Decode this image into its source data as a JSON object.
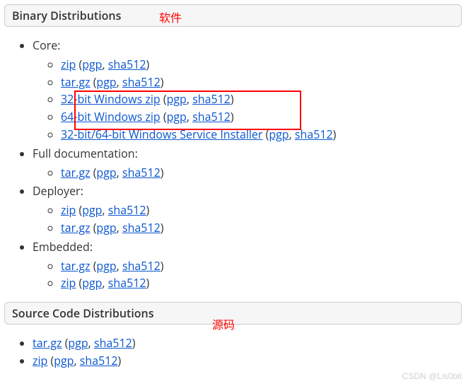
{
  "binary": {
    "header": "Binary Distributions",
    "core_label": "Core:",
    "full_doc_label": "Full documentation:",
    "deployer_label": "Deployer:",
    "embedded_label": "Embedded:",
    "items": {
      "core": [
        {
          "name": "zip",
          "pgp": "pgp",
          "sha": "sha512"
        },
        {
          "name": "tar.gz",
          "pgp": "pgp",
          "sha": "sha512"
        },
        {
          "name": "32-bit Windows zip",
          "pgp": "pgp",
          "sha": "sha512"
        },
        {
          "name": "64-bit Windows zip",
          "pgp": "pgp",
          "sha": "sha512"
        },
        {
          "name": "32-bit/64-bit Windows Service Installer",
          "pgp": "pgp",
          "sha": "sha512"
        }
      ],
      "full_doc": [
        {
          "name": "tar.gz",
          "pgp": "pgp",
          "sha": "sha512"
        }
      ],
      "deployer": [
        {
          "name": "zip",
          "pgp": "pgp",
          "sha": "sha512"
        },
        {
          "name": "tar.gz",
          "pgp": "pgp",
          "sha": "sha512"
        }
      ],
      "embedded": [
        {
          "name": "tar.gz",
          "pgp": "pgp",
          "sha": "sha512"
        },
        {
          "name": "zip",
          "pgp": "pgp",
          "sha": "sha512"
        }
      ]
    }
  },
  "source": {
    "header": "Source Code Distributions",
    "items": [
      {
        "name": "tar.gz",
        "pgp": "pgp",
        "sha": "sha512"
      },
      {
        "name": "zip",
        "pgp": "pgp",
        "sha": "sha512"
      }
    ]
  },
  "annotations": {
    "software": "软件",
    "source": "源码"
  },
  "watermark": "CSDN @Lis0bit"
}
